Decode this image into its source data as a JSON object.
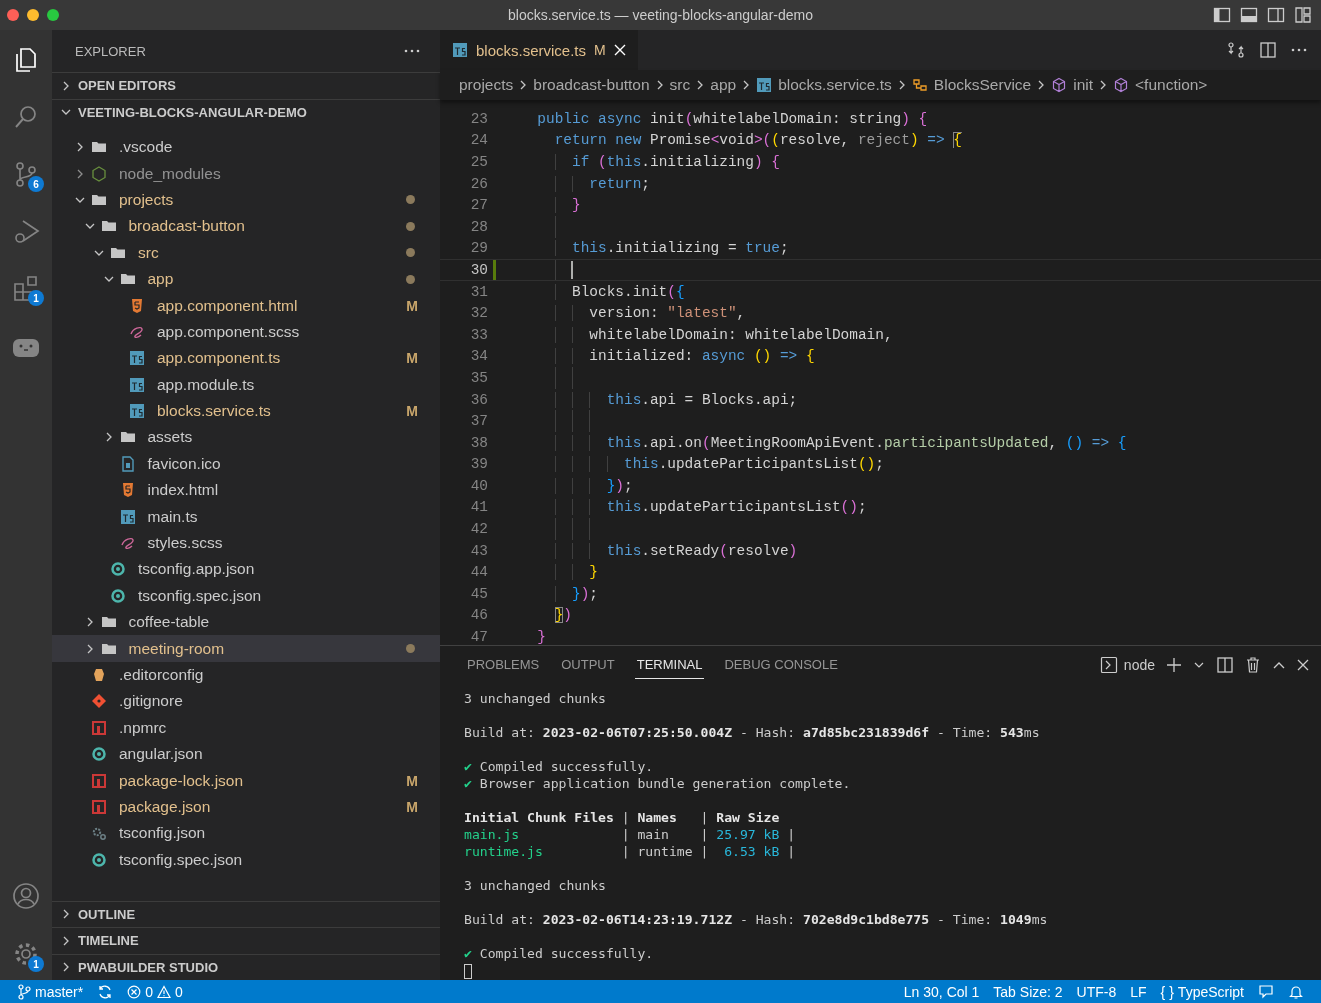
{
  "window": {
    "title": "blocks.service.ts — veeting-blocks-angular-demo"
  },
  "activity_bar": {
    "items": [
      {
        "kind": "files",
        "selected": true
      },
      {
        "kind": "search",
        "selected": false
      },
      {
        "kind": "source-control",
        "selected": false,
        "badge": "6"
      },
      {
        "kind": "run",
        "selected": false
      },
      {
        "kind": "extensions",
        "selected": false,
        "badge": "1"
      },
      {
        "kind": "animal",
        "selected": false
      }
    ],
    "bottom": [
      {
        "kind": "account"
      },
      {
        "kind": "gear",
        "badge": "1"
      }
    ]
  },
  "sidebar": {
    "title": "EXPLORER",
    "sections": [
      {
        "label": "OPEN EDITORS",
        "expanded": false
      },
      {
        "label": "VEETING-BLOCKS-ANGULAR-DEMO",
        "expanded": true,
        "tree": [
          {
            "kind": "folder",
            "label": ".vscode",
            "expanded": false,
            "modified": false,
            "ignored": false,
            "dot": false,
            "selected": false
          },
          {
            "kind": "node-folder",
            "label": "node_modules",
            "expanded": false,
            "modified": false,
            "ignored": true,
            "dot": false,
            "selected": false
          },
          {
            "kind": "folder",
            "label": "projects",
            "expanded": true,
            "modified": true,
            "ignored": false,
            "dot": true,
            "selected": false,
            "children": [
              {
                "kind": "folder",
                "label": "broadcast-button",
                "expanded": true,
                "modified": true,
                "ignored": false,
                "dot": true,
                "selected": false,
                "children": [
                  {
                    "kind": "folder",
                    "label": "src",
                    "expanded": true,
                    "modified": true,
                    "ignored": false,
                    "dot": true,
                    "selected": false,
                    "children": [
                      {
                        "kind": "folder",
                        "label": "app",
                        "expanded": true,
                        "modified": true,
                        "ignored": false,
                        "dot": true,
                        "selected": false,
                        "children": [
                          {
                            "kind": "html",
                            "label": "app.component.html",
                            "modified": true,
                            "ignored": false,
                            "badge": "M",
                            "dot": false,
                            "selected": false
                          },
                          {
                            "kind": "sass",
                            "label": "app.component.scss",
                            "modified": false,
                            "ignored": false,
                            "dot": false,
                            "selected": false
                          },
                          {
                            "kind": "ts",
                            "label": "app.component.ts",
                            "modified": true,
                            "ignored": false,
                            "badge": "M",
                            "dot": false,
                            "selected": false
                          },
                          {
                            "kind": "ts",
                            "label": "app.module.ts",
                            "modified": false,
                            "ignored": false,
                            "dot": false,
                            "selected": false
                          },
                          {
                            "kind": "ts",
                            "label": "blocks.service.ts",
                            "modified": true,
                            "ignored": false,
                            "badge": "M",
                            "dot": false,
                            "selected": false
                          }
                        ]
                      },
                      {
                        "kind": "folder",
                        "label": "assets",
                        "expanded": false,
                        "modified": false,
                        "ignored": false,
                        "dot": false,
                        "selected": false
                      },
                      {
                        "kind": "image",
                        "label": "favicon.ico",
                        "modified": false,
                        "ignored": false,
                        "dot": false,
                        "selected": false
                      },
                      {
                        "kind": "html",
                        "label": "index.html",
                        "modified": false,
                        "ignored": false,
                        "dot": false,
                        "selected": false
                      },
                      {
                        "kind": "ts",
                        "label": "main.ts",
                        "modified": false,
                        "ignored": false,
                        "dot": false,
                        "selected": false
                      },
                      {
                        "kind": "sass",
                        "label": "styles.scss",
                        "modified": false,
                        "ignored": false,
                        "dot": false,
                        "selected": false
                      }
                    ]
                  },
                  {
                    "kind": "ring",
                    "label": "tsconfig.app.json",
                    "modified": false,
                    "ignored": false,
                    "dot": false,
                    "selected": false
                  },
                  {
                    "kind": "ring",
                    "label": "tsconfig.spec.json",
                    "modified": false,
                    "ignored": false,
                    "dot": false,
                    "selected": false
                  }
                ]
              },
              {
                "kind": "folder",
                "label": "coffee-table",
                "expanded": false,
                "modified": false,
                "ignored": false,
                "dot": false,
                "selected": false
              },
              {
                "kind": "folder",
                "label": "meeting-room",
                "expanded": false,
                "modified": true,
                "ignored": false,
                "dot": true,
                "selected": true
              }
            ]
          },
          {
            "kind": "editorconfig",
            "label": ".editorconfig",
            "modified": false,
            "ignored": false,
            "dot": false,
            "selected": false
          },
          {
            "kind": "git",
            "label": ".gitignore",
            "modified": false,
            "ignored": false,
            "dot": false,
            "selected": false
          },
          {
            "kind": "npm",
            "label": ".npmrc",
            "modified": false,
            "ignored": false,
            "dot": false,
            "selected": false
          },
          {
            "kind": "ring",
            "label": "angular.json",
            "modified": false,
            "ignored": false,
            "dot": false,
            "selected": false
          },
          {
            "kind": "npm",
            "label": "package-lock.json",
            "modified": true,
            "ignored": false,
            "badge": "M",
            "dot": false,
            "selected": false
          },
          {
            "kind": "npm",
            "label": "package.json",
            "modified": true,
            "ignored": false,
            "badge": "M",
            "dot": false,
            "selected": false
          },
          {
            "kind": "gear",
            "label": "tsconfig.json",
            "modified": false,
            "ignored": false,
            "dot": false,
            "selected": false
          },
          {
            "kind": "ring",
            "label": "tsconfig.spec.json",
            "modified": false,
            "ignored": false,
            "dot": false,
            "selected": false
          }
        ]
      },
      {
        "label": "OUTLINE",
        "expanded": false
      },
      {
        "label": "TIMELINE",
        "expanded": false
      },
      {
        "label": "PWABUILDER STUDIO",
        "expanded": false
      }
    ]
  },
  "editor": {
    "tabs": [
      {
        "kind": "ts",
        "label": "blocks.service.ts",
        "badge": "M"
      }
    ],
    "breadcrumbs": [
      {
        "label": "projects"
      },
      {
        "label": "broadcast-button"
      },
      {
        "label": "src"
      },
      {
        "label": "app"
      },
      {
        "kind": "ts",
        "label": "blocks.service.ts"
      },
      {
        "kind": "class",
        "label": "BlocksService"
      },
      {
        "kind": "method",
        "label": "init"
      },
      {
        "kind": "method",
        "label": "<function>"
      }
    ],
    "lines": [
      {
        "n": "23",
        "current": false,
        "changed": false,
        "tokens": [
          {
            "kind": "kw",
            "t": "  public async "
          },
          {
            "kind": "txt",
            "t": "init"
          },
          {
            "kind": "b2",
            "t": "("
          },
          {
            "kind": "txt",
            "t": "whitelabelDomain: string"
          },
          {
            "kind": "b2",
            "t": ") {"
          }
        ]
      },
      {
        "n": "24",
        "current": false,
        "changed": false,
        "tokens": [
          {
            "kind": "kw",
            "t": "    return new "
          },
          {
            "kind": "txt",
            "t": "Promise"
          },
          {
            "kind": "b2",
            "t": "<"
          },
          {
            "kind": "txt",
            "t": "void"
          },
          {
            "kind": "b2",
            "t": ">("
          },
          {
            "kind": "b1",
            "t": "("
          },
          {
            "kind": "txt",
            "t": "resolve, "
          },
          {
            "kind": "dim",
            "t": "reject"
          },
          {
            "kind": "b1",
            "t": ")"
          },
          {
            "kind": "kw",
            "t": " => "
          },
          {
            "kind": "match",
            "t": "{"
          }
        ]
      },
      {
        "n": "25",
        "current": false,
        "changed": false,
        "tokens": [
          {
            "kind": "kw",
            "t": "      if "
          },
          {
            "kind": "b2",
            "t": "("
          },
          {
            "kind": "kw",
            "t": "this"
          },
          {
            "kind": "txt",
            "t": ".initializing"
          },
          {
            "kind": "b2",
            "t": ") {"
          }
        ]
      },
      {
        "n": "26",
        "current": false,
        "changed": false,
        "tokens": [
          {
            "kind": "kw",
            "t": "        return"
          },
          {
            "kind": "txt",
            "t": ";"
          }
        ]
      },
      {
        "n": "27",
        "current": false,
        "changed": false,
        "tokens": [
          {
            "kind": "b2",
            "t": "      }"
          }
        ]
      },
      {
        "n": "28",
        "current": false,
        "changed": false
      },
      {
        "n": "29",
        "current": false,
        "changed": false,
        "tokens": [
          {
            "kind": "kw",
            "t": "      this"
          },
          {
            "kind": "txt",
            "t": ".initializing = "
          },
          {
            "kind": "kw",
            "t": "true"
          },
          {
            "kind": "txt",
            "t": ";"
          }
        ]
      },
      {
        "n": "30",
        "current": true,
        "changed": true
      },
      {
        "n": "31",
        "current": false,
        "changed": false,
        "tokens": [
          {
            "kind": "txt",
            "t": "      Blocks.init"
          },
          {
            "kind": "b2",
            "t": "("
          },
          {
            "kind": "b3",
            "t": "{"
          }
        ]
      },
      {
        "n": "32",
        "current": false,
        "changed": false,
        "tokens": [
          {
            "kind": "txt",
            "t": "        version: "
          },
          {
            "kind": "str",
            "t": "\"latest\""
          },
          {
            "kind": "txt",
            "t": ","
          }
        ]
      },
      {
        "n": "33",
        "current": false,
        "changed": false,
        "tokens": [
          {
            "kind": "txt",
            "t": "        whitelabelDomain: whitelabelDomain,"
          }
        ]
      },
      {
        "n": "34",
        "current": false,
        "changed": false,
        "tokens": [
          {
            "kind": "txt",
            "t": "        initialized: "
          },
          {
            "kind": "kw",
            "t": "async "
          },
          {
            "kind": "b1",
            "t": "()"
          },
          {
            "kind": "kw",
            "t": " => "
          },
          {
            "kind": "b1",
            "t": "{"
          }
        ]
      },
      {
        "n": "35",
        "current": false,
        "changed": false
      },
      {
        "n": "36",
        "current": false,
        "changed": false,
        "tokens": [
          {
            "kind": "kw",
            "t": "          this"
          },
          {
            "kind": "txt",
            "t": ".api = Blocks.api;"
          }
        ]
      },
      {
        "n": "37",
        "current": false,
        "changed": false
      },
      {
        "n": "38",
        "current": false,
        "changed": false,
        "tokens": [
          {
            "kind": "kw",
            "t": "          this"
          },
          {
            "kind": "txt",
            "t": ".api.on"
          },
          {
            "kind": "b2",
            "t": "("
          },
          {
            "kind": "txt",
            "t": "MeetingRoomApiEvent."
          },
          {
            "kind": "member",
            "t": "participantsUpdated"
          },
          {
            "kind": "txt",
            "t": ", "
          },
          {
            "kind": "b3",
            "t": "()"
          },
          {
            "kind": "kw",
            "t": " => "
          },
          {
            "kind": "b3",
            "t": "{"
          }
        ]
      },
      {
        "n": "39",
        "current": false,
        "changed": false,
        "tokens": [
          {
            "kind": "kw",
            "t": "            this"
          },
          {
            "kind": "txt",
            "t": ".updateParticipantsList"
          },
          {
            "kind": "b1",
            "t": "()"
          },
          {
            "kind": "txt",
            "t": ";"
          }
        ]
      },
      {
        "n": "40",
        "current": false,
        "changed": false,
        "tokens": [
          {
            "kind": "b3",
            "t": "          }"
          },
          {
            "kind": "b2",
            "t": ")"
          },
          {
            "kind": "txt",
            "t": ";"
          }
        ]
      },
      {
        "n": "41",
        "current": false,
        "changed": false,
        "tokens": [
          {
            "kind": "kw",
            "t": "          this"
          },
          {
            "kind": "txt",
            "t": ".updateParticipantsList"
          },
          {
            "kind": "b2",
            "t": "()"
          },
          {
            "kind": "txt",
            "t": ";"
          }
        ]
      },
      {
        "n": "42",
        "current": false,
        "changed": false
      },
      {
        "n": "43",
        "current": false,
        "changed": false,
        "tokens": [
          {
            "kind": "kw",
            "t": "          this"
          },
          {
            "kind": "txt",
            "t": ".setReady"
          },
          {
            "kind": "b2",
            "t": "("
          },
          {
            "kind": "txt",
            "t": "resolve"
          },
          {
            "kind": "b2",
            "t": ")"
          }
        ]
      },
      {
        "n": "44",
        "current": false,
        "changed": false,
        "tokens": [
          {
            "kind": "b1",
            "t": "        }"
          }
        ]
      },
      {
        "n": "45",
        "current": false,
        "changed": false,
        "tokens": [
          {
            "kind": "b3",
            "t": "      }"
          },
          {
            "kind": "b2",
            "t": ")"
          },
          {
            "kind": "txt",
            "t": ";"
          }
        ]
      },
      {
        "n": "46",
        "current": false,
        "changed": false,
        "tokens": [
          {
            "kind": "match",
            "t": "    }"
          },
          {
            "kind": "b2",
            "t": ")"
          }
        ]
      },
      {
        "n": "47",
        "current": false,
        "changed": false,
        "tokens": [
          {
            "kind": "b2",
            "t": "  }"
          }
        ]
      }
    ]
  },
  "panel": {
    "tabs": [
      {
        "label": "PROBLEMS",
        "selected": false
      },
      {
        "label": "OUTPUT",
        "selected": false
      },
      {
        "label": "TERMINAL",
        "selected": true
      },
      {
        "label": "DEBUG CONSOLE",
        "selected": false
      }
    ],
    "terminal": {
      "shell": "node",
      "lines": [
        {
          "kind": "text",
          "segments": [
            {
              "kind": "plain",
              "t": "3 unchanged chunks"
            }
          ]
        },
        {
          "kind": "blank"
        },
        {
          "kind": "text",
          "segments": [
            {
              "kind": "plain",
              "t": "Build at: "
            },
            {
              "kind": "bold",
              "t": "2023-02-06T07:25:50.004Z"
            },
            {
              "kind": "plain",
              "t": " - Hash: "
            },
            {
              "kind": "bold",
              "t": "a7d85bc231839d6f"
            },
            {
              "kind": "plain",
              "t": " - Time: "
            },
            {
              "kind": "bold",
              "t": "543"
            },
            {
              "kind": "plain",
              "t": "ms"
            }
          ]
        },
        {
          "kind": "blank"
        },
        {
          "kind": "text",
          "segments": [
            {
              "kind": "ok",
              "t": "✔"
            },
            {
              "kind": "plain",
              "t": " Compiled successfully."
            }
          ]
        },
        {
          "kind": "text",
          "segments": [
            {
              "kind": "ok",
              "t": "✔"
            },
            {
              "kind": "plain",
              "t": " Browser application bundle generation complete."
            }
          ]
        },
        {
          "kind": "blank"
        },
        {
          "kind": "text",
          "segments": [
            {
              "kind": "bold",
              "t": "Initial Chunk Files"
            },
            {
              "kind": "plain",
              "t": " | "
            },
            {
              "kind": "bold",
              "t": "Names"
            },
            {
              "kind": "plain",
              "t": "   | "
            },
            {
              "kind": "bold",
              "t": "Raw Size"
            }
          ]
        },
        {
          "kind": "text",
          "segments": [
            {
              "kind": "file",
              "t": "main.js"
            },
            {
              "kind": "plain",
              "t": "             | main    | "
            },
            {
              "kind": "size",
              "t": "25.97 kB"
            },
            {
              "kind": "plain",
              "t": " |"
            }
          ]
        },
        {
          "kind": "text",
          "segments": [
            {
              "kind": "file",
              "t": "runtime.js"
            },
            {
              "kind": "plain",
              "t": "          | runtime |  "
            },
            {
              "kind": "size",
              "t": "6.53 kB"
            },
            {
              "kind": "plain",
              "t": " |"
            }
          ]
        },
        {
          "kind": "blank"
        },
        {
          "kind": "text",
          "segments": [
            {
              "kind": "plain",
              "t": "3 unchanged chunks"
            }
          ]
        },
        {
          "kind": "blank"
        },
        {
          "kind": "text",
          "segments": [
            {
              "kind": "plain",
              "t": "Build at: "
            },
            {
              "kind": "bold",
              "t": "2023-02-06T14:23:19.712Z"
            },
            {
              "kind": "plain",
              "t": " - Hash: "
            },
            {
              "kind": "bold",
              "t": "702e8d9c1bd8e775"
            },
            {
              "kind": "plain",
              "t": " - Time: "
            },
            {
              "kind": "bold",
              "t": "1049"
            },
            {
              "kind": "plain",
              "t": "ms"
            }
          ]
        },
        {
          "kind": "blank"
        },
        {
          "kind": "text",
          "segments": [
            {
              "kind": "ok",
              "t": "✔"
            },
            {
              "kind": "plain",
              "t": " Compiled successfully."
            }
          ]
        },
        {
          "kind": "cursor"
        }
      ]
    }
  },
  "status_bar": {
    "branch": "master*",
    "errors": "0",
    "warnings": "0",
    "position": "Ln 30, Col 1",
    "tab_size": "Tab Size: 2",
    "encoding": "UTF-8",
    "eol": "LF",
    "language_icon": "{ }",
    "language": "TypeScript"
  }
}
